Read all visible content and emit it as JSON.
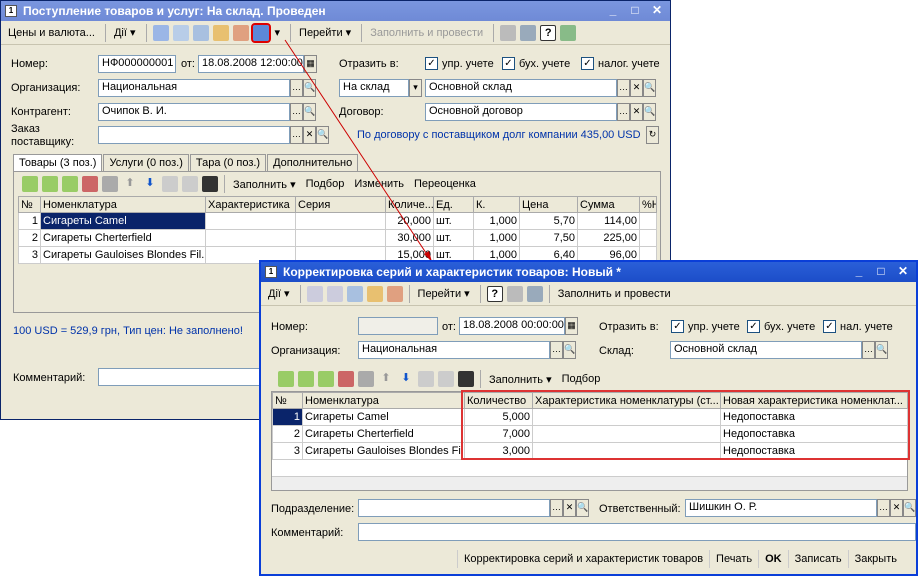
{
  "w1": {
    "title": "Поступление товаров и услуг: На склад. Проведен",
    "toolbar": {
      "prices": "Цены и валюта...",
      "actions": "Дії",
      "goto": "Перейти",
      "fill_post": "Заполнить и провести"
    },
    "number_label": "Номер:",
    "number": "НФ000000001",
    "from_label": "от:",
    "date": "18.08.2008 12:00:00",
    "reflect_label": "Отразить в:",
    "chk_mgmt": "упр. учете",
    "chk_acc": "бух. учете",
    "chk_tax": "налог. учете",
    "org_label": "Организация:",
    "org": "Национальная",
    "wh_type": "На склад",
    "warehouse": "Основной склад",
    "contractor_label": "Контрагент:",
    "contractor": "Очипок В. И.",
    "contract_label": "Договор:",
    "contract": "Основной договор",
    "order_label": "Заказ\nпоставщику:",
    "debt_text": "По договору с поставщиком долг компании 435,00 USD",
    "tabs": [
      "Товары (3 поз.)",
      "Услуги (0 поз.)",
      "Тара (0 поз.)",
      "Дополнительно"
    ],
    "grid_toolbar": {
      "fill": "Заполнить",
      "pick": "Подбор",
      "change": "Изменить",
      "reval": "Переоценка"
    },
    "columns": [
      "№",
      "Номенклатура",
      "Характеристика",
      "Серия",
      "Количе...",
      "Ед.",
      "К.",
      "Цена",
      "Сумма",
      "%Н"
    ],
    "rows": [
      {
        "n": "1",
        "name": "Сигареты Camel",
        "qty": "20,000",
        "unit": "шт.",
        "k": "1,000",
        "price": "5,70",
        "sum": "114,00"
      },
      {
        "n": "2",
        "name": "Сигареты Cherterfield",
        "qty": "30,000",
        "unit": "шт.",
        "k": "1,000",
        "price": "7,50",
        "sum": "225,00"
      },
      {
        "n": "3",
        "name": "Сигареты Gauloises Blondes Fil...",
        "qty": "15,000",
        "unit": "шт.",
        "k": "1,000",
        "price": "6,40",
        "sum": "96,00"
      }
    ],
    "rate_text": "100 USD = 529,9 грн, Тип цен: Не заполнено!",
    "comment_label": "Комментарий:"
  },
  "w2": {
    "title": "Корректировка серий и характеристик товаров: Новый *",
    "toolbar": {
      "actions": "Дії",
      "goto": "Перейти",
      "fill_post": "Заполнить и провести"
    },
    "number_label": "Номер:",
    "number": "",
    "from_label": "от:",
    "date": "18.08.2008 00:00:00",
    "reflect_label": "Отразить в:",
    "chk_mgmt": "упр. учете",
    "chk_acc": "бух. учете",
    "chk_tax": "нал. учете",
    "org_label": "Организация:",
    "org": "Национальная",
    "wh_label": "Склад:",
    "warehouse": "Основной склад",
    "grid_toolbar": {
      "fill": "Заполнить",
      "pick": "Подбор"
    },
    "columns": [
      "№",
      "Номенклатура",
      "Количество",
      "Характеристика номенклатуры (ст...",
      "Новая характеристика номенклат..."
    ],
    "rows": [
      {
        "n": "1",
        "name": "Сигареты Camel",
        "qty": "5,000",
        "old": "",
        "new": "Недопоставка"
      },
      {
        "n": "2",
        "name": "Сигареты Cherterfield",
        "qty": "7,000",
        "old": "",
        "new": "Недопоставка"
      },
      {
        "n": "3",
        "name": "Сигареты Gauloises Blondes Fil...",
        "qty": "3,000",
        "old": "",
        "new": "Недопоставка"
      }
    ],
    "dept_label": "Подразделение:",
    "resp_label": "Ответственный:",
    "resp": "Шишкин О. Р.",
    "comment_label": "Комментарий:",
    "buttons": {
      "report": "Корректировка серий и характеристик товаров",
      "print": "Печать",
      "ok": "OK",
      "save": "Записать",
      "close": "Закрыть"
    }
  }
}
